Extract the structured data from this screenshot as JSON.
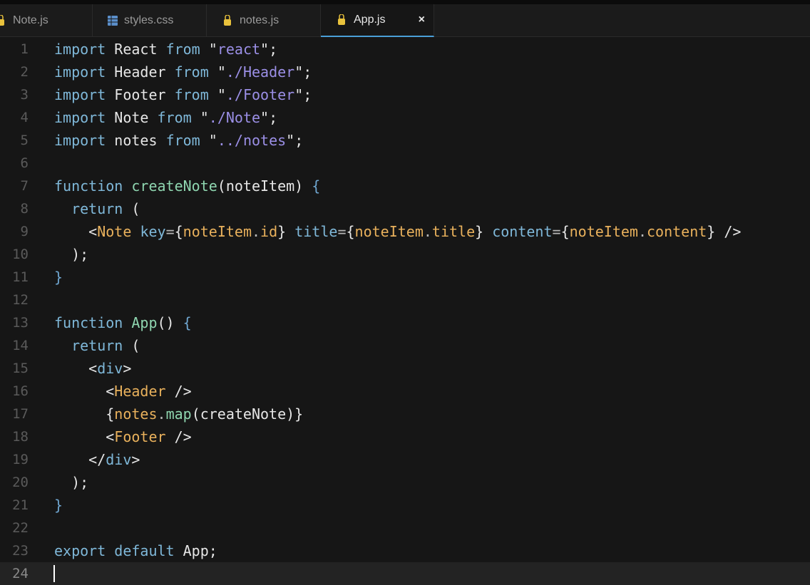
{
  "tabs": [
    {
      "label": "Note.js",
      "icon": "js-file-icon",
      "active": false
    },
    {
      "label": "styles.css",
      "icon": "css-file-icon",
      "active": false
    },
    {
      "label": "notes.js",
      "icon": "js-file-icon",
      "active": false
    },
    {
      "label": "App.js",
      "icon": "js-file-icon",
      "active": true,
      "close": "×"
    }
  ],
  "editor": {
    "line_numbers": [
      "1",
      "2",
      "3",
      "4",
      "5",
      "6",
      "7",
      "8",
      "9",
      "10",
      "11",
      "12",
      "13",
      "14",
      "15",
      "16",
      "17",
      "18",
      "19",
      "20",
      "21",
      "22",
      "23",
      "24"
    ],
    "lines": [
      "import React from \"react\";",
      "import Header from \"./Header\";",
      "import Footer from \"./Footer\";",
      "import Note from \"./Note\";",
      "import notes from \"../notes\";",
      "",
      "function createNote(noteItem) {",
      "  return (",
      "    <Note key={noteItem.id} title={noteItem.title} content={noteItem.content} />",
      "  );",
      "}",
      "",
      "function App() {",
      "  return (",
      "    <div>",
      "      <Header />",
      "      {notes.map(createNote)}",
      "      <Footer />",
      "    </div>",
      "  );",
      "}",
      "",
      "export default App;",
      ""
    ],
    "current_line": 24
  },
  "colors": {
    "background": "#161616",
    "keyword": "#7fb8d9",
    "string": "#9b8fe6",
    "function": "#8fd6b0",
    "jsx_tag": "#e9b15c",
    "tab_accent": "#4a9fd8"
  }
}
